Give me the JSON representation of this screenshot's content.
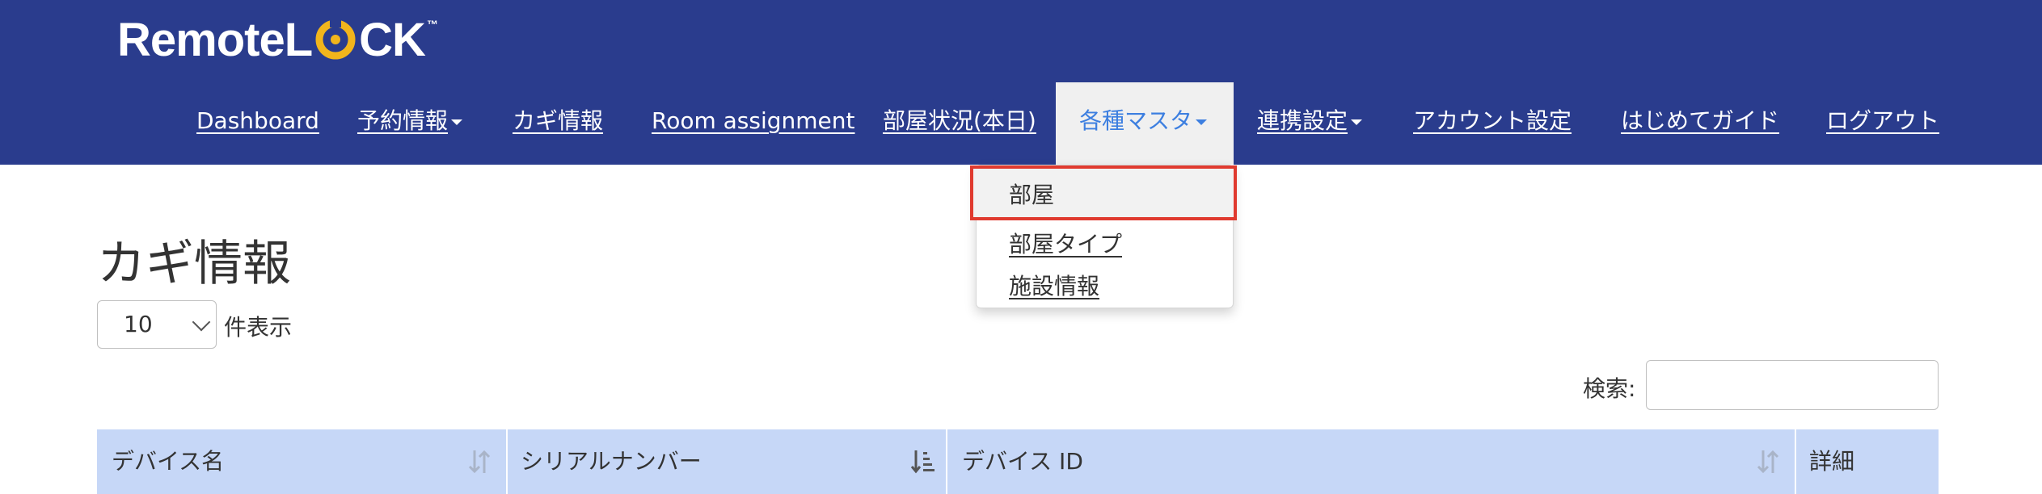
{
  "app": {
    "logo_text_left": "Remote",
    "logo_text_right": "CK",
    "logo_tm": "™"
  },
  "nav": {
    "items": [
      {
        "label": "Dashboard"
      },
      {
        "label": "予約情報"
      },
      {
        "label": "カギ情報"
      },
      {
        "label": "Room assignment"
      },
      {
        "label": "部屋状況(本日)"
      },
      {
        "label": "各種マスタ"
      },
      {
        "label": "連携設定"
      },
      {
        "label": "アカウント設定"
      },
      {
        "label": "はじめてガイド"
      },
      {
        "label": "ログアウト"
      }
    ],
    "active_index": 5
  },
  "dropdown": {
    "items": [
      {
        "label": "部屋"
      },
      {
        "label": "部屋タイプ"
      },
      {
        "label": "施設情報"
      }
    ]
  },
  "page": {
    "title": "カギ情報"
  },
  "length": {
    "value": "10",
    "label": "件表示"
  },
  "search": {
    "label": "検索:",
    "value": ""
  },
  "table": {
    "columns": [
      {
        "label": "デバイス名"
      },
      {
        "label": "シリアルナンバー"
      },
      {
        "label": "デバイス ID"
      },
      {
        "label": "詳細"
      }
    ]
  },
  "colors": {
    "navbar": "#2a3c8d",
    "accent": "#3d7fe0",
    "highlight_border": "#e03a2f",
    "table_header": "#c6d7f7",
    "logo_ring": "#f2b51c"
  }
}
